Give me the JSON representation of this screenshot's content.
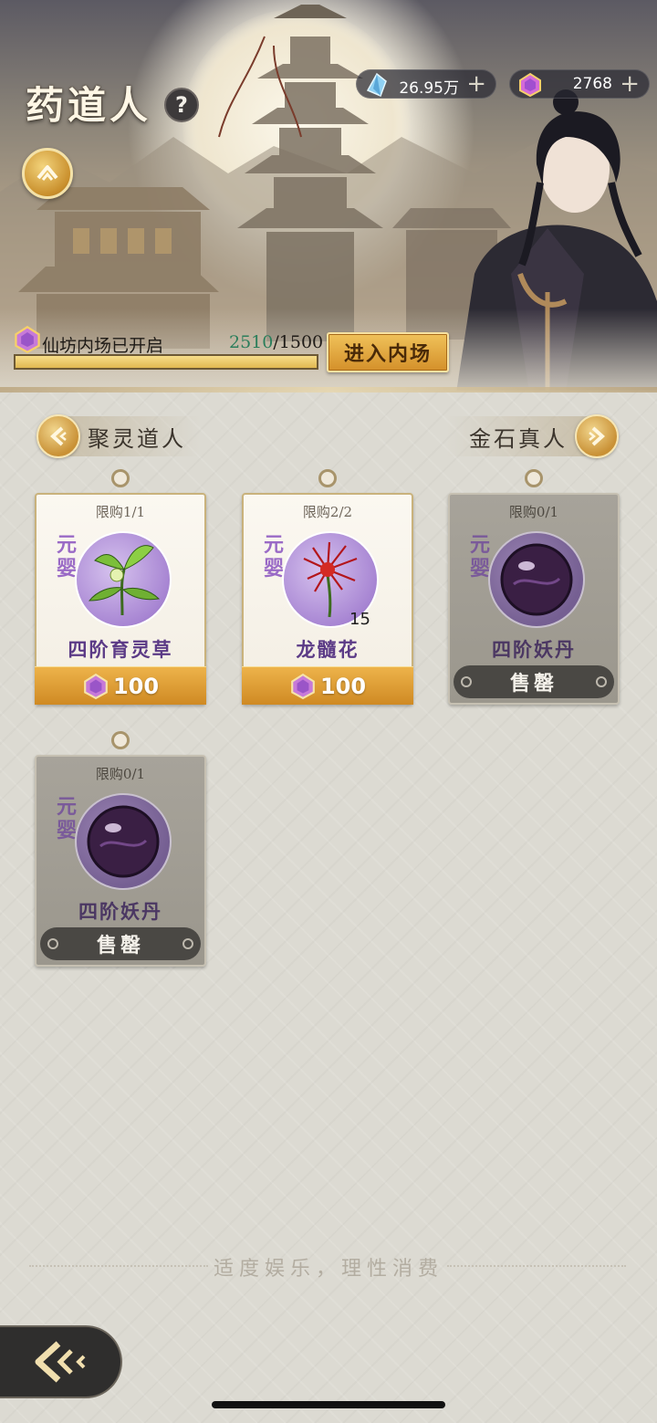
{
  "header": {
    "title": "药道人",
    "help_label": "?",
    "upgrade_icon": "chevron-up-icon"
  },
  "currencies": [
    {
      "icon": "spirit-stone-icon",
      "value": "26.95万",
      "add_label": "+"
    },
    {
      "icon": "purple-gem-icon",
      "value": "2768",
      "add_label": "+"
    }
  ],
  "inner_market": {
    "label": "仙坊内场已开启",
    "current": "2510",
    "separator": "/",
    "target": "1500",
    "fill_fraction": 1.0,
    "enter_label": "进入内场"
  },
  "nav": {
    "prev_label": "聚灵道人",
    "next_label": "金石真人"
  },
  "shop_items": [
    {
      "limit": "限购1/1",
      "tier": "元婴",
      "name": "四阶育灵草",
      "price": "100",
      "quantity": "",
      "sold_out": false,
      "icon": "herb-icon"
    },
    {
      "limit": "限购2/2",
      "tier": "元婴",
      "name": "龙髓花",
      "price": "100",
      "quantity": "15",
      "sold_out": false,
      "icon": "red-flower-icon"
    },
    {
      "limit": "限购0/1",
      "tier": "元婴",
      "name": "四阶妖丹",
      "sold_label": "售罄",
      "sold_out": true,
      "icon": "demon-core-orb-icon"
    },
    {
      "limit": "限购0/1",
      "tier": "元婴",
      "name": "四阶妖丹",
      "sold_label": "售罄",
      "sold_out": true,
      "icon": "demon-core-orb-icon"
    }
  ],
  "footer": {
    "notice": "适度娱乐，理性消费",
    "back_icon": "back-arrow-icon"
  },
  "colors": {
    "accent_gold": "#d4902a",
    "tier_purple": "#9a6ac6",
    "progress_green": "#2b7e5b"
  }
}
